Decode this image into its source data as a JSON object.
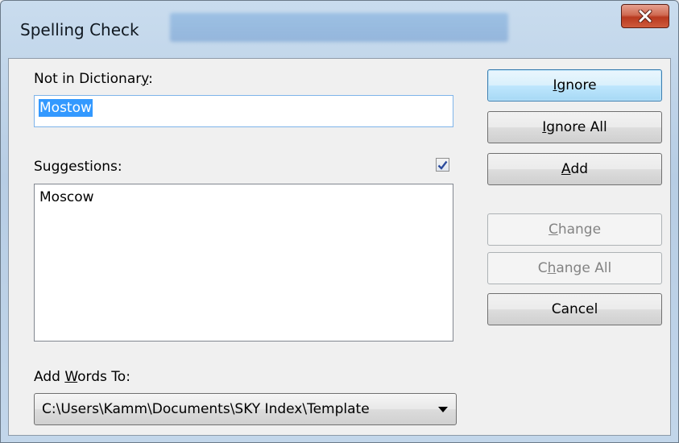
{
  "window": {
    "title": "Spelling Check",
    "close_icon": "close-icon"
  },
  "not_in_dictionary": {
    "label_pre": "Not in Dictionar",
    "label_mnemonic": "y",
    "label_post": ":",
    "value": "Mostow"
  },
  "suggestions": {
    "label": "Suggestions:",
    "checkbox_checked": true,
    "items": [
      "Moscow"
    ]
  },
  "add_words_to": {
    "label_pre": "Add ",
    "label_mnemonic": "W",
    "label_post": "ords To:",
    "selected": "C:\\Users\\Kamm\\Documents\\SKY Index\\Template"
  },
  "buttons": {
    "ignore": {
      "mnemonic": "I",
      "rest": "gnore"
    },
    "ignore_all": {
      "mnemonic": "I",
      "rest": "gnore All"
    },
    "add": {
      "mnemonic": "A",
      "rest": "dd"
    },
    "change": {
      "mnemonic": "C",
      "rest": "hange"
    },
    "change_all": {
      "pre": "C",
      "mnemonic": "h",
      "rest": "ange All"
    },
    "cancel": {
      "label": "Cancel"
    }
  },
  "colors": {
    "selection": "#3399ff",
    "default_button_border": "#3c7fb1",
    "close_button": "#c9462b"
  }
}
